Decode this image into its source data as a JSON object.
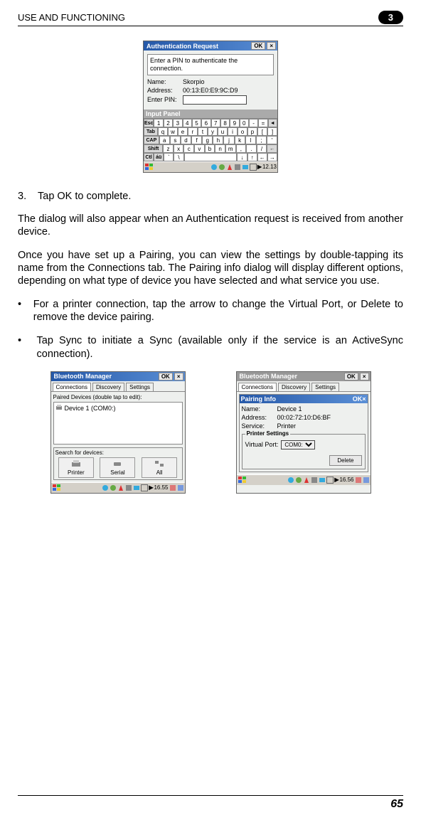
{
  "header": {
    "title": "USE AND FUNCTIONING",
    "chapter_badge": "3"
  },
  "auth_dialog": {
    "title": "Authentication Request",
    "ok_label": "OK",
    "close_label": "×",
    "message": "Enter a PIN to authenticate the connection.",
    "name_label": "Name:",
    "name_value": "Skorpio",
    "address_label": "Address:",
    "address_value": "00:13:E0:E9:9C:D9",
    "pin_label": "Enter PIN:",
    "pin_value": "",
    "input_panel_label": "Input Panel",
    "keyboard": {
      "row1": [
        "Esc",
        "1",
        "2",
        "3",
        "4",
        "5",
        "6",
        "7",
        "8",
        "9",
        "0",
        "-",
        "=",
        "◄"
      ],
      "row2": [
        "Tab",
        "q",
        "w",
        "e",
        "r",
        "t",
        "y",
        "u",
        "i",
        "o",
        "p",
        "[",
        "]"
      ],
      "row3": [
        "CAP",
        "a",
        "s",
        "d",
        "f",
        "g",
        "h",
        "j",
        "k",
        "l",
        ";",
        "'"
      ],
      "row4": [
        "Shift",
        "z",
        "x",
        "c",
        "v",
        "b",
        "n",
        "m",
        ",",
        ".",
        "/",
        "←"
      ],
      "row5": [
        "Ctl",
        "áü",
        "`",
        "\\",
        " ",
        "↓",
        "↑",
        "←",
        "→"
      ]
    },
    "time": "12.13"
  },
  "step3": {
    "number": "3.",
    "text": "Tap OK to complete."
  },
  "para1": "The dialog will also appear when an Authentication request is received from another device.",
  "para2": "Once you have set up a Pairing, you can view the settings by double-tapping its name from the Connections tab. The Pairing info dialog will display different options, depending on what type of device you have selected and what service you use.",
  "bullet1": "For a printer connection, tap the arrow to change the Virtual Port, or Delete to remove the device pairing.",
  "bullet2": "Tap Sync to initiate a Sync (available only if the service is an ActiveSync connection).",
  "bt_manager_left": {
    "title": "Bluetooth Manager",
    "ok_label": "OK",
    "close_label": "×",
    "tabs": [
      "Connections",
      "Discovery",
      "Settings"
    ],
    "active_tab": 0,
    "list_label": "Paired Devices (double tap to edit):",
    "device": "Device 1 (COM0:)",
    "search_label": "Search for devices:",
    "search_buttons": [
      "Printer",
      "Serial",
      "All"
    ],
    "time": "16.55"
  },
  "bt_manager_right": {
    "title": "Bluetooth Manager",
    "ok_label": "OK",
    "close_label": "×",
    "tabs": [
      "Connections",
      "Discovery",
      "Settings"
    ],
    "active_tab": 0,
    "pairing_title": "Pairing Info",
    "pairing_ok": "OK",
    "pairing_close": "×",
    "name_label": "Name:",
    "name_value": "Device 1",
    "address_label": "Address:",
    "address_value": "00:02:72:10:D6:BF",
    "service_label": "Service:",
    "service_value": "Printer",
    "printer_settings_label": "Printer Settings",
    "virtual_port_label": "Virtual Port:",
    "virtual_port_value": "COM0:",
    "delete_label": "Delete",
    "time": "16.56"
  },
  "footer": {
    "page_number": "65"
  }
}
